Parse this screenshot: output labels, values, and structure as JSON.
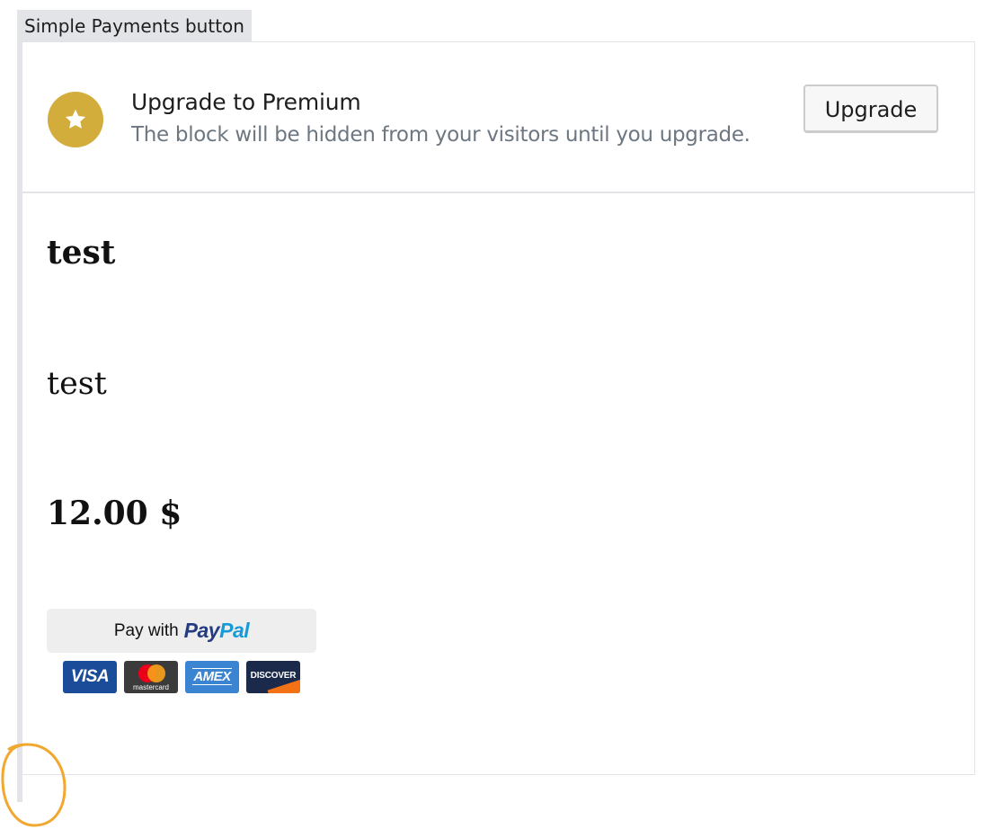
{
  "block": {
    "label": "Simple Payments button"
  },
  "nudge": {
    "icon": "star-icon",
    "title": "Upgrade to Premium",
    "text": "The block will be hidden from your visitors until you upgrade.",
    "button_label": "Upgrade"
  },
  "product": {
    "title": "test",
    "description": "test",
    "price": "12.00 $"
  },
  "paypal": {
    "prefix": "Pay with",
    "brand_pay": "Pay",
    "brand_pal": "Pal"
  },
  "cards": {
    "visa": "VISA",
    "mastercard": "mastercard",
    "amex": "AMEX",
    "discover": "DISCOVER"
  },
  "colors": {
    "star_badge": "#d2ad3c",
    "paypal_dark": "#253b80",
    "paypal_light": "#179bd7",
    "annotation": "#f0a830",
    "rail": "#e2e4e7"
  }
}
